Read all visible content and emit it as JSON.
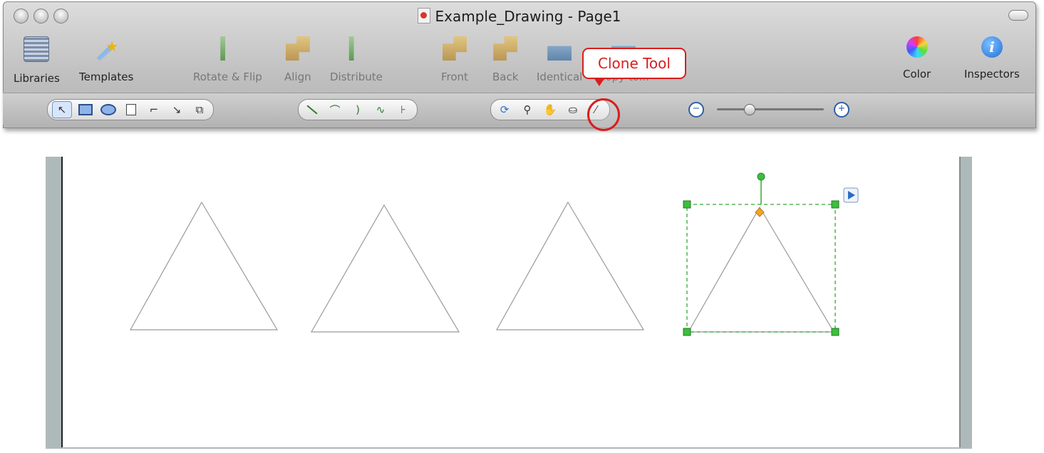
{
  "window": {
    "title": "Example_Drawing  -  Page1"
  },
  "toolbar": {
    "items": [
      {
        "label": "Libraries",
        "icon": "libraries-icon",
        "enabled": true
      },
      {
        "label": "Templates",
        "icon": "templates-icon",
        "enabled": true
      },
      {
        "label": "Rotate & Flip",
        "icon": "rotate-flip-icon",
        "enabled": false
      },
      {
        "label": "Align",
        "icon": "align-icon",
        "enabled": false
      },
      {
        "label": "Distribute",
        "icon": "distribute-icon",
        "enabled": false
      },
      {
        "label": "Front",
        "icon": "bring-front-icon",
        "enabled": false
      },
      {
        "label": "Back",
        "icon": "send-back-icon",
        "enabled": false
      },
      {
        "label": "Identical",
        "icon": "identical-icon",
        "enabled": false
      },
      {
        "label": "Copy to...",
        "icon": "copy-to-icon",
        "enabled": false
      },
      {
        "label": "Color",
        "icon": "color-wheel-icon",
        "enabled": true
      },
      {
        "label": "Inspectors",
        "icon": "info-icon",
        "enabled": true
      }
    ]
  },
  "tools": {
    "drawing": [
      "pointer",
      "rectangle",
      "ellipse",
      "text",
      "connector",
      "direct-connector",
      "insert"
    ],
    "lines": [
      "line",
      "arc",
      "curve",
      "bezier",
      "spline"
    ],
    "view": [
      "rotate",
      "zoom",
      "hand",
      "clone",
      "eyedropper"
    ],
    "zoom_level": 0.3
  },
  "callout": {
    "text": "Clone Tool"
  },
  "canvas": {
    "shape_count": 4,
    "selected_shape": 4,
    "stroke_color": "#9a9a9a",
    "selection_color": "#35a835",
    "handle_fill": "#3cbf3c",
    "control_point_color": "#f4a521"
  },
  "colors": {
    "accent_red": "#d81e1e"
  }
}
